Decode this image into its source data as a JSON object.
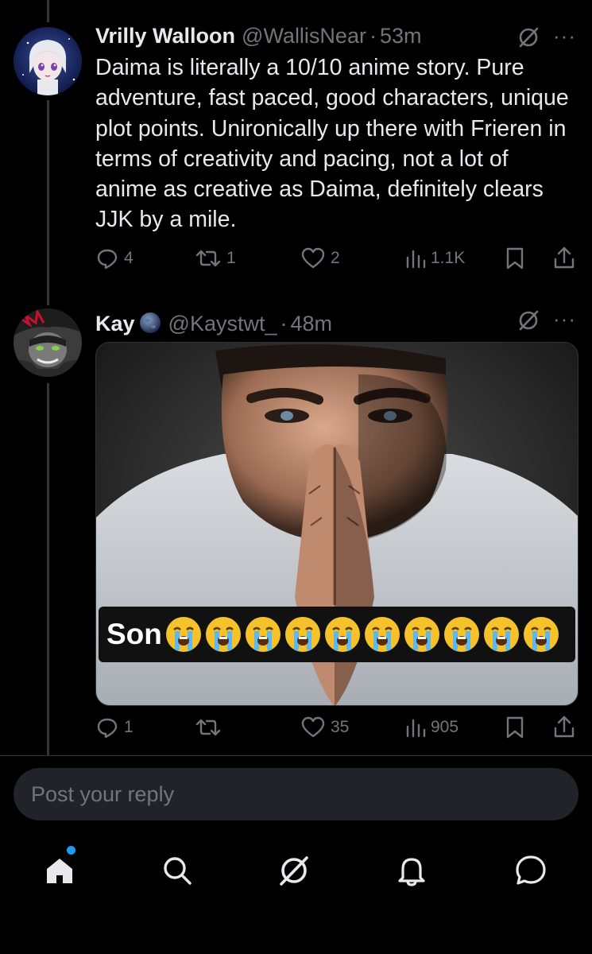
{
  "tweet1": {
    "name": "Vrilly Walloon",
    "handle": "@WallisNear",
    "time": "53m",
    "text": "Daima is literally a 10/10 anime story. Pure adventure, fast paced, good characters, unique plot points. Unironically up there with Frieren in terms of creativity and pacing, not a lot of anime as creative as Daima, definitely clears JJK by a mile.",
    "replies": "4",
    "reposts": "1",
    "likes": "2",
    "views": "1.1K"
  },
  "tweet2": {
    "name": "Kay",
    "handle": "@Kaystwt_",
    "time": "48m",
    "media_caption": "Son",
    "media_emoji": "😭",
    "media_emoji_count": 10,
    "replies": "1",
    "reposts": "",
    "likes": "35",
    "views": "905"
  },
  "separator": "·",
  "more_label": "···",
  "reply_box": {
    "placeholder": "Post your reply"
  },
  "nav": {
    "items": [
      {
        "icon": "home-icon"
      },
      {
        "icon": "search-icon"
      },
      {
        "icon": "grok-icon"
      },
      {
        "icon": "bell-icon"
      },
      {
        "icon": "messages-icon"
      }
    ]
  },
  "colors": {
    "background": "#000000",
    "text": "#e7e9ea",
    "muted": "#71767b",
    "accent": "#1d9bf0",
    "reply_box": "#202327"
  }
}
